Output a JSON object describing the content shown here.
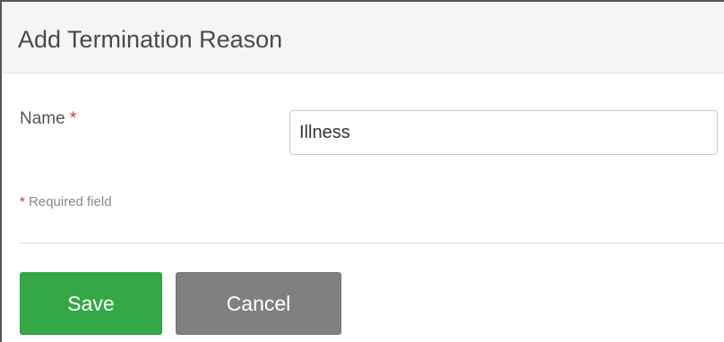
{
  "dialog": {
    "title": "Add Termination Reason"
  },
  "form": {
    "name_label": "Name",
    "required_marker": "*",
    "name_value": "Illness",
    "required_note_marker": "*",
    "required_note_text": "Required field"
  },
  "actions": {
    "save_label": "Save",
    "cancel_label": "Cancel"
  },
  "colors": {
    "save": "#34a847",
    "cancel": "#808080",
    "required": "#e0302e",
    "header_bg": "#f5f5f5"
  }
}
